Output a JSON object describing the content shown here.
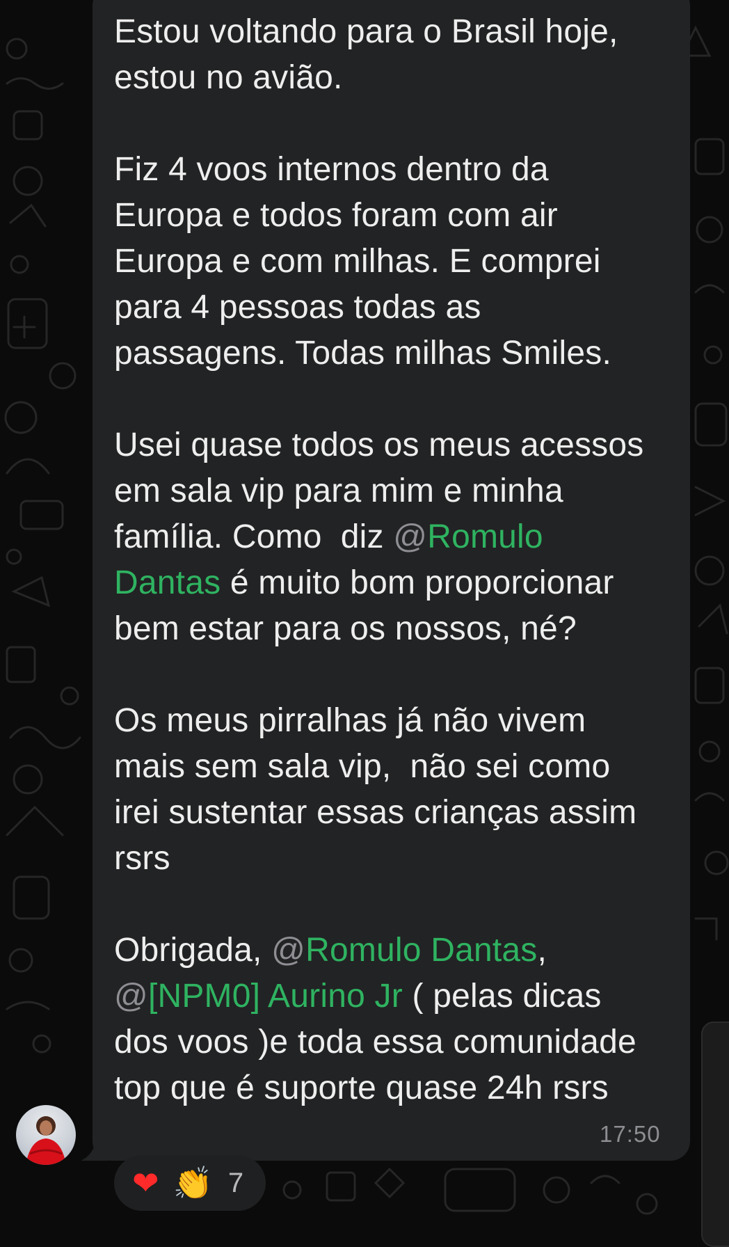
{
  "message": {
    "paragraphs": [
      [
        {
          "text": "Estou voltando para o Brasil hoje,\nestou no avião."
        }
      ],
      [
        {
          "text": "Fiz 4 voos internos dentro da\nEuropa e todos foram com air\nEuropa e com milhas. E comprei\npara 4 pessoas todas as\npassagens. Todas milhas Smiles."
        }
      ],
      [
        {
          "text": "Usei quase todos os meus acessos\nem sala vip para mim e minha\nfamília. Como  diz "
        },
        {
          "mention_at": "@",
          "mention_name": "Romulo\nDantas"
        },
        {
          "text": " é muito bom proporcionar\nbem estar para os nossos, né?"
        }
      ],
      [
        {
          "text": "Os meus pirralhas já não vivem\nmais sem sala vip,  não sei como\nirei sustentar essas crianças assim\nrsrs"
        }
      ],
      [
        {
          "text": "Obrigada, "
        },
        {
          "mention_at": "@",
          "mention_name": "Romulo Dantas"
        },
        {
          "text": ",\n"
        },
        {
          "mention_at": "@",
          "mention_name": "[NPM0] Aurino Jr"
        },
        {
          "text": " ( pelas dicas\ndos voos )e toda essa comunidade\ntop que é suporte quase 24h rsrs"
        }
      ]
    ],
    "timestamp": "17:50"
  },
  "reactions": {
    "emojis": [
      {
        "glyph": "❤",
        "icon": "red-heart-icon"
      },
      {
        "glyph": "👏",
        "icon": "clapping-hands-icon"
      }
    ],
    "count": "7"
  },
  "colors": {
    "bubble": "#222324",
    "text": "#eeeeee",
    "mention": "#2fb361",
    "mention_at": "#8e8e93",
    "timestamp": "#8d8d92",
    "background": "#0b0b0b"
  }
}
